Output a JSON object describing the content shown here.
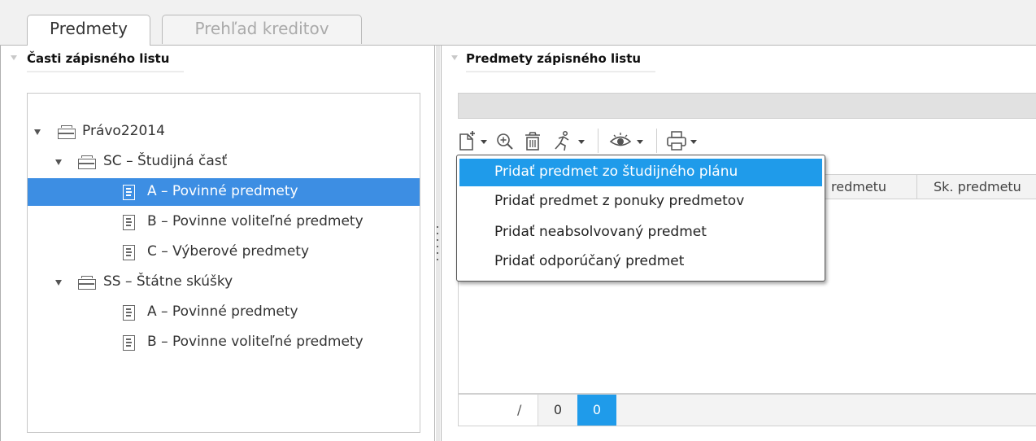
{
  "tabs": [
    {
      "label": "Predmety"
    },
    {
      "label": "Prehľad kreditov"
    }
  ],
  "left_panel": {
    "title": "Časti zápisného listu",
    "tree": [
      {
        "label": "Právo22014",
        "type": "folder",
        "expanded": true
      },
      {
        "label": "SC – Študijná časť",
        "type": "folder",
        "expanded": true
      },
      {
        "label": "A – Povinné predmety",
        "type": "doc",
        "selected": true
      },
      {
        "label": "B – Povinne voliteľné predmety",
        "type": "doc"
      },
      {
        "label": "C – Výberové predmety",
        "type": "doc"
      },
      {
        "label": "SS – Štátne skúšky",
        "type": "folder",
        "expanded": true
      },
      {
        "label": "A – Povinné predmety",
        "type": "doc"
      },
      {
        "label": "B – Povinne voliteľné predmety",
        "type": "doc"
      }
    ]
  },
  "right_panel": {
    "title": "Predmety zápisného listu",
    "toolbar": [
      {
        "icon": "new-document-icon",
        "dropdown": true
      },
      {
        "icon": "zoom-icon"
      },
      {
        "icon": "trash-icon"
      },
      {
        "icon": "running-man-icon",
        "dropdown": true
      },
      {
        "icon": "eye-icon",
        "dropdown": true
      },
      {
        "icon": "printer-icon",
        "dropdown": true
      }
    ],
    "grid": {
      "columns": [
        "redmetu",
        "Sk. predmetu"
      ]
    },
    "status": {
      "current": "",
      "separator": "/",
      "total": "0",
      "selected": "0"
    }
  },
  "menu": {
    "items": [
      {
        "label": "Pridať predmet zo študijného plánu",
        "highlighted": true
      },
      {
        "label": "Pridať predmet z ponuky predmetov"
      },
      {
        "label": "Pridať neabsolvovaný predmet"
      },
      {
        "label": "Pridať odporúčaný predmet"
      }
    ]
  },
  "colors": {
    "selection": "#3d8ee3",
    "menu_highlight": "#1f9bea",
    "status_selected": "#1f9bea"
  }
}
